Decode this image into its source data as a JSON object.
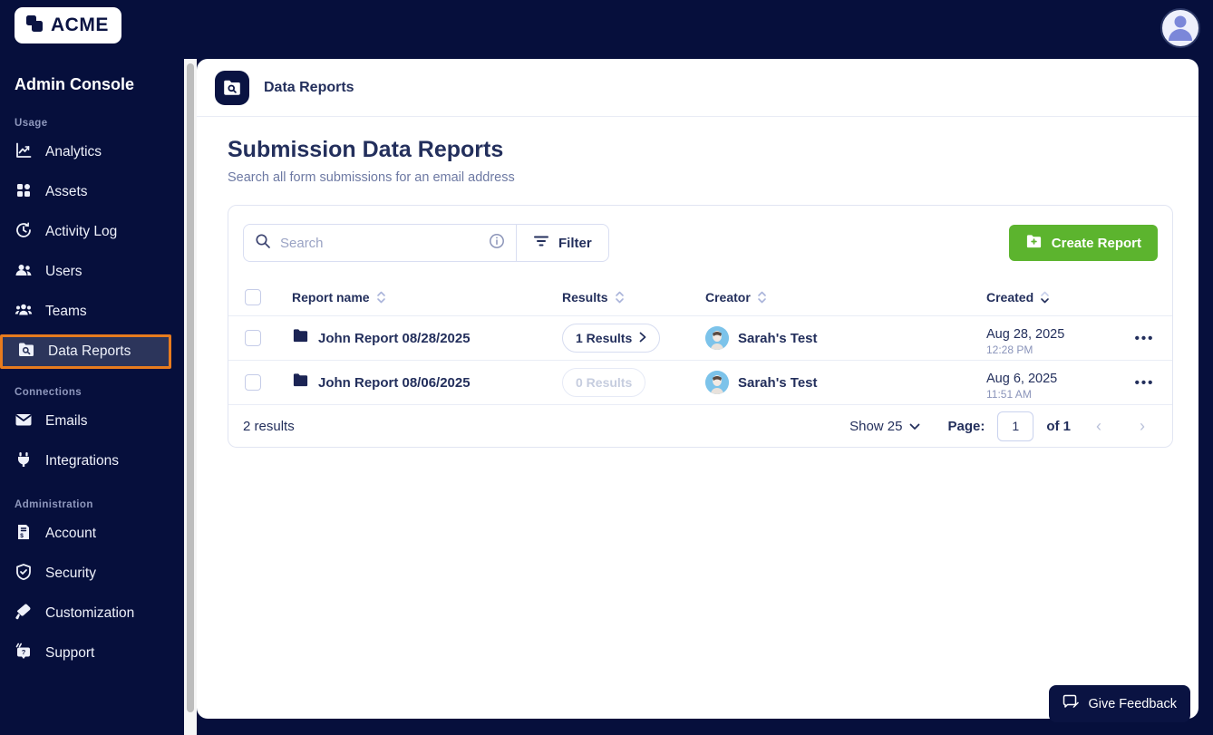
{
  "brand": {
    "logo_text": "ACME"
  },
  "sidebar": {
    "title": "Admin Console",
    "sections": [
      {
        "label": "Usage",
        "items": [
          {
            "label": "Analytics",
            "icon": "analytics-icon"
          },
          {
            "label": "Assets",
            "icon": "assets-icon"
          },
          {
            "label": "Activity Log",
            "icon": "activity-log-icon"
          },
          {
            "label": "Users",
            "icon": "users-icon"
          },
          {
            "label": "Teams",
            "icon": "teams-icon"
          },
          {
            "label": "Data Reports",
            "icon": "data-reports-icon",
            "active": true
          }
        ]
      },
      {
        "label": "Connections",
        "items": [
          {
            "label": "Emails",
            "icon": "email-icon"
          },
          {
            "label": "Integrations",
            "icon": "plug-icon"
          }
        ]
      },
      {
        "label": "Administration",
        "items": [
          {
            "label": "Account",
            "icon": "account-icon"
          },
          {
            "label": "Security",
            "icon": "shield-icon"
          },
          {
            "label": "Customization",
            "icon": "paint-roller-icon"
          },
          {
            "label": "Support",
            "icon": "support-icon"
          }
        ]
      }
    ]
  },
  "header": {
    "title": "Data Reports"
  },
  "page": {
    "title": "Submission Data Reports",
    "subtitle": "Search all form submissions for an email address"
  },
  "toolbar": {
    "search_placeholder": "Search",
    "filter_label": "Filter",
    "create_report_label": "Create Report"
  },
  "table": {
    "columns": {
      "name": "Report name",
      "results": "Results",
      "creator": "Creator",
      "created": "Created"
    },
    "rows": [
      {
        "name": "John Report 08/28/2025",
        "results": "1 Results",
        "creator": "Sarah's Test",
        "created_date": "Aug 28, 2025",
        "created_time": "12:28 PM"
      },
      {
        "name": "John Report 08/06/2025",
        "results": "0 Results",
        "creator": "Sarah's Test",
        "created_date": "Aug 6, 2025",
        "created_time": "11:51 AM"
      }
    ]
  },
  "footer": {
    "results_summary": "2 results",
    "show_label": "Show 25",
    "page_label": "Page:",
    "page_value": "1",
    "of_label": "of 1"
  },
  "feedback": {
    "label": "Give Feedback"
  },
  "colors": {
    "navy_bg": "#060f3c",
    "navy_text": "#232f5c",
    "active_border_orange": "#e87b1e",
    "create_button_green": "#5cb42e",
    "muted_text": "#8a94ba"
  }
}
